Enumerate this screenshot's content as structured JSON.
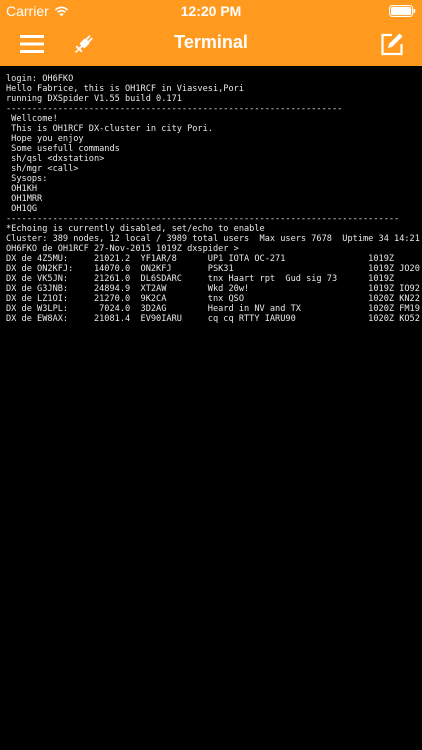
{
  "status_bar": {
    "carrier": "Carrier",
    "time": "12:20 PM",
    "icons": {
      "wifi": "wifi-icon",
      "battery": "battery-icon"
    }
  },
  "nav": {
    "title": "Terminal",
    "icons": {
      "left": "hamburger-menu-icon",
      "plug": "plug-icon",
      "right": "edit-icon"
    }
  },
  "colors": {
    "accent": "#FF9A1F",
    "terminal_bg": "#000000",
    "terminal_text": "#e8e8e8"
  },
  "terminal": {
    "lines": [
      "login: OH6FKO",
      "Hello Fabrice, this is OH1RCF in Viasvesi,Pori",
      "running DXSpider V1.55 build 0.171",
      "-----------------------------------------------------------------",
      " Wellcome!",
      " This is OH1RCF DX-cluster in city Pori.",
      " Hope you enjoy",
      " Some usefull commands",
      " sh/qsl <dxstation>",
      " sh/mgr <call>",
      " Sysops:",
      " OH1KH",
      " OH1MRR",
      " OH1QG",
      "----------------------------------------------------------------------------",
      "*Echoing is currently disabled, set/echo to enable",
      "Cluster: 389 nodes, 12 local / 3989 total users  Max users 7678  Uptime 34 14:21",
      "OH6FKO de OH1RCF 27-Nov-2015 1019Z dxspider >",
      "DX de 4Z5MU:     21021.2  YF1AR/8      UP1 IOTA OC-271                1019Z",
      "DX de ON2KFJ:    14070.0  ON2KFJ       PSK31                          1019Z JO20",
      "DX de VK5JN:     21261.0  DL6SDARC     tnx Haart rpt  Gud sig 73      1019Z",
      "DX de G3JNB:     24894.9  XT2AW        Wkd 20w!                       1019Z IO92",
      "DX de LZ1OI:     21270.0  9K2CA        tnx QSO                        1020Z KN22",
      "DX de W3LPL:      7024.0  3D2AG        Heard in NV and TX             1020Z FM19",
      "DX de EW8AX:     21081.4  EV90IARU     cq cq RTTY IARU90              1020Z KO52"
    ]
  }
}
